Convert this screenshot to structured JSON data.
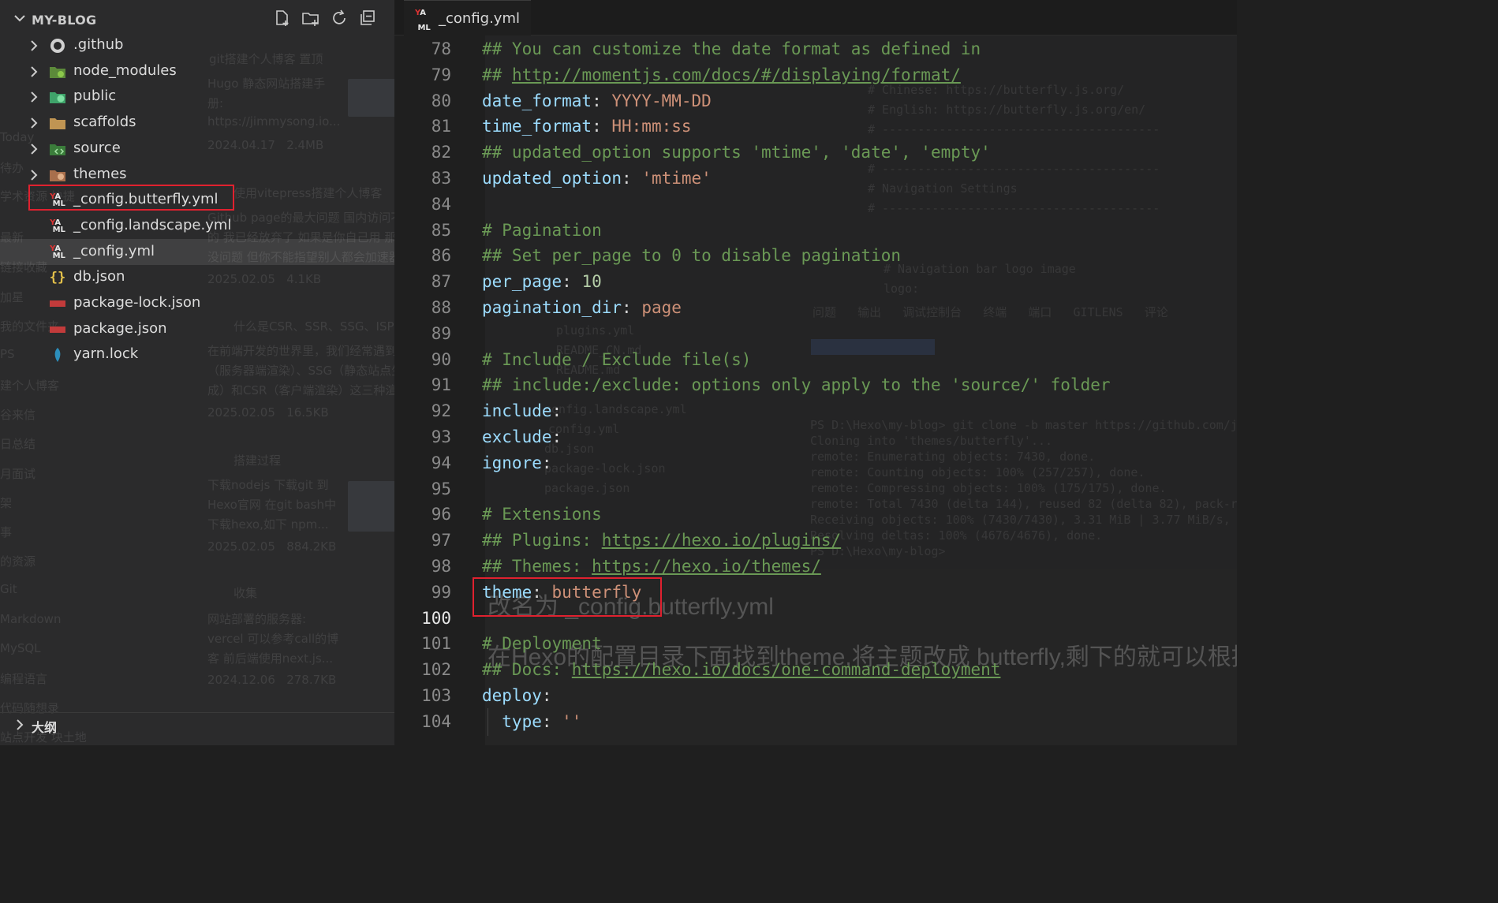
{
  "explorer": {
    "project_title": "MY-BLOG",
    "files": [
      {
        "name": ".github",
        "icon": "github-folder-icon",
        "is_folder": true
      },
      {
        "name": "node_modules",
        "icon": "node-folder-icon",
        "is_folder": true
      },
      {
        "name": "public",
        "icon": "public-folder-icon",
        "is_folder": true
      },
      {
        "name": "scaffolds",
        "icon": "folder-icon",
        "is_folder": true
      },
      {
        "name": "source",
        "icon": "source-folder-icon",
        "is_folder": true
      },
      {
        "name": "themes",
        "icon": "themes-folder-icon",
        "is_folder": true
      },
      {
        "name": "_config.butterfly.yml",
        "icon": "yaml-icon",
        "is_folder": false,
        "highlighted": true
      },
      {
        "name": "_config.landscape.yml",
        "icon": "yaml-icon",
        "is_folder": false
      },
      {
        "name": "_config.yml",
        "icon": "yaml-icon",
        "is_folder": false,
        "active": true
      },
      {
        "name": "db.json",
        "icon": "json-icon",
        "is_folder": false
      },
      {
        "name": "package-lock.json",
        "icon": "npm-icon",
        "is_folder": false
      },
      {
        "name": "package.json",
        "icon": "npm-icon",
        "is_folder": false
      },
      {
        "name": "yarn.lock",
        "icon": "yarn-icon",
        "is_folder": false
      }
    ],
    "outline_label": "大纲"
  },
  "editor": {
    "tab_label": "_config.yml",
    "current_line": 100,
    "lines": [
      {
        "n": "78",
        "text": "## You can customize the date format as defined in"
      },
      {
        "n": "79",
        "text": "## http://momentjs.com/docs/#/displaying/format/"
      },
      {
        "n": "80",
        "key": "date_format",
        "value": "YYYY-MM-DD"
      },
      {
        "n": "81",
        "key": "time_format",
        "value": "HH:mm:ss"
      },
      {
        "n": "82",
        "text": "## updated_option supports 'mtime', 'date', 'empty'"
      },
      {
        "n": "83",
        "key": "updated_option",
        "value": "'mtime'"
      },
      {
        "n": "84",
        "text": ""
      },
      {
        "n": "85",
        "text": "# Pagination"
      },
      {
        "n": "86",
        "text": "## Set per_page to 0 to disable pagination"
      },
      {
        "n": "87",
        "key": "per_page",
        "value": "10"
      },
      {
        "n": "88",
        "key": "pagination_dir",
        "value": "page"
      },
      {
        "n": "89",
        "text": ""
      },
      {
        "n": "90",
        "text": "# Include / Exclude file(s)"
      },
      {
        "n": "91",
        "text": "## include:/exclude: options only apply to the 'source/' folder"
      },
      {
        "n": "92",
        "key": "include",
        "value": ""
      },
      {
        "n": "93",
        "key": "exclude",
        "value": ""
      },
      {
        "n": "94",
        "key": "ignore",
        "value": ""
      },
      {
        "n": "95",
        "text": ""
      },
      {
        "n": "96",
        "text": "# Extensions"
      },
      {
        "n": "97",
        "text": "## Plugins: https://hexo.io/plugins/"
      },
      {
        "n": "98",
        "text": "## Themes: https://hexo.io/themes/"
      },
      {
        "n": "99",
        "key": "theme",
        "value": "butterfly"
      },
      {
        "n": "100",
        "text": ""
      },
      {
        "n": "101",
        "text": "# Deployment"
      },
      {
        "n": "102",
        "text": "## Docs: https://hexo.io/docs/one-command-deployment"
      },
      {
        "n": "103",
        "key": "deploy",
        "value": ""
      },
      {
        "n": "104",
        "key": "  type",
        "value": "''"
      }
    ]
  },
  "colors": {
    "comment": "#6a9955",
    "key": "#9cdcfe",
    "string": "#ce9178",
    "number": "#b5cea8",
    "highlight_box": "#e0212f"
  }
}
